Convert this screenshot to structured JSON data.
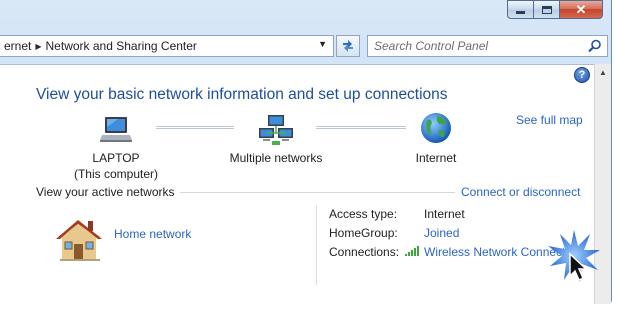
{
  "window": {
    "minimize_icon": "minimize-icon",
    "maximize_icon": "maximize-icon",
    "close_glyph": "✕"
  },
  "address_bar": {
    "crumbs": [
      "ernet",
      "Network and Sharing Center"
    ]
  },
  "search": {
    "placeholder": "Search Control Panel"
  },
  "help": {
    "glyph": "?"
  },
  "main": {
    "heading": "View your basic network information and set up connections",
    "see_full_map": "See full map",
    "nodes": [
      {
        "label": "LAPTOP",
        "sublabel": "(This computer)",
        "icon": "laptop-icon"
      },
      {
        "label": "Multiple networks",
        "icon": "multiple-networks-icon"
      },
      {
        "label": "Internet",
        "icon": "globe-icon"
      }
    ],
    "active_networks_label": "View your active networks",
    "connect_or_disconnect": "Connect or disconnect",
    "network_name": "Home network",
    "network_icon": "home-network-icon",
    "properties": [
      {
        "label": "Access type:",
        "value": "Internet"
      },
      {
        "label": "HomeGroup:",
        "value": "Joined"
      },
      {
        "label": "Connections:",
        "value": "Wireless Network Connection"
      }
    ],
    "signal_icon": "wireless-signal-icon"
  },
  "colors": {
    "link": "#2a64c4",
    "heading": "#1e4e9a",
    "chrome": "#c6dcf2",
    "close_button": "#c2452b"
  }
}
